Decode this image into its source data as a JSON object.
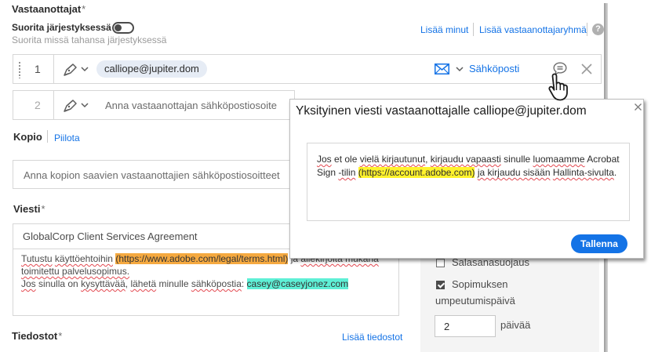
{
  "recipients": {
    "title": "Vastaanottajat",
    "required_mark": "*",
    "sequence_label": "Suorita järjestyksessä",
    "sequence_sub": "Suorita missä tahansa järjestyksessä",
    "sequence_on": false,
    "add_me": "Lisää minut",
    "add_group": "Lisää vastaanottajaryhmä",
    "help": "?",
    "rows": [
      {
        "number": "1",
        "email": "calliope@jupiter.dom",
        "delivery": "Sähköposti"
      },
      {
        "number": "2",
        "placeholder": "Anna vastaanottajan sähköpostiosoite"
      }
    ]
  },
  "cc": {
    "title": "Kopio",
    "hide": "Piilota",
    "placeholder": "Anna kopion saavien vastaanottajien sähköpostiosoitteet"
  },
  "message": {
    "title": "Viesti",
    "required_mark": "*",
    "subject": "GlobalCorp Client Services Agreement",
    "line1_a": "Tutustu",
    "line1_b": " ",
    "line1_c": "käyttöehtoihin",
    "line1_d": " ",
    "line1_link": "(https://www.adobe.com/legal/terms.html)",
    "line1_e": " ja ",
    "line1_f": "allekirjoita mukana",
    "line2": "toimitettu palvelusopimus.",
    "line3_a": "Jos",
    "line3_b": " sinulla on ",
    "line3_c": "kysyttävää",
    "line3_d": ", ",
    "line3_e": "lähetä",
    "line3_f": " minulle ",
    "line3_g": "sähköpostia",
    "line3_h": ": ",
    "line3_email": "casey@caseyjonez.com"
  },
  "files": {
    "title": "Tiedostot",
    "required_mark": "*",
    "add": "Lisää tiedostot"
  },
  "options": {
    "password": "Salasanasuojaus",
    "password_checked": false,
    "expiry_line1": "Sopimuksen",
    "expiry_line2": "umpeutumispäivä",
    "expiry_checked": true,
    "days_value": "2",
    "days_label": "päivää"
  },
  "popup": {
    "title": "Yksityinen viesti vastaanottajalle calliope@jupiter.dom",
    "t1": "Jos",
    "t2": " et ole ",
    "t3": "vielä kirjautunut",
    "t4": ", ",
    "t5": "kirjaudu vapaasti",
    "t6": " sinulle ",
    "t7": "luomaamme",
    "t8": " Acrobat Sign ",
    "t9": "-tilin",
    "t10": " ",
    "t_link": "(https://account.adobe.com)",
    "t11": " ",
    "t12": "ja kirjaudu sisään",
    "t13": " ",
    "t14": "Hallinta-sivulta",
    "t15": ".",
    "save": "Tallenna"
  },
  "colors": {
    "accent": "#1473e6",
    "highlight_orange": "#f5a940",
    "highlight_cyan": "#5ef0d6",
    "highlight_yellow": "#fff32c"
  }
}
